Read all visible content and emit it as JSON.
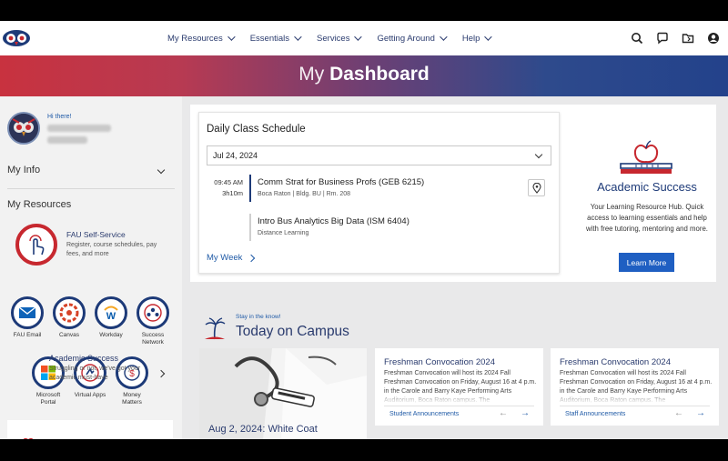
{
  "nav": {
    "items": [
      {
        "label": "My Resources"
      },
      {
        "label": "Essentials"
      },
      {
        "label": "Services"
      },
      {
        "label": "Getting Around"
      },
      {
        "label": "Help"
      }
    ],
    "icons": [
      "search-icon",
      "chat-icon",
      "folder-icon",
      "user-icon"
    ]
  },
  "banner": {
    "title_light": "My ",
    "title_bold": "Dashboard"
  },
  "sidebar": {
    "greeting": "Hi there!",
    "my_info": "My Info",
    "my_resources": "My Resources",
    "self_service": {
      "title": "FAU Self-Service",
      "description": "Register, course schedules, pay fees, and more"
    },
    "apps": [
      {
        "label": "FAU Email",
        "icon": "mail-icon"
      },
      {
        "label": "Canvas",
        "icon": "canvas-icon"
      },
      {
        "label": "Workday",
        "icon": "workday-icon"
      },
      {
        "label": "Success Network",
        "icon": "network-icon"
      },
      {
        "label": "Microsoft Portal",
        "icon": "microsoft-icon"
      },
      {
        "label": "Virtual Apps",
        "icon": "virtual-apps-icon"
      },
      {
        "label": "Money Matters",
        "icon": "money-icon"
      }
    ],
    "academic_success": {
      "title": "Academic Success",
      "description": "Struggling or not, we've got your academic must-have"
    }
  },
  "schedule": {
    "title": "Daily Class Schedule",
    "date": "Jul 24, 2024",
    "classes": [
      {
        "time": "09:45 AM",
        "duration": "3h10m",
        "name": "Comm Strat for Business Profs (GEB 6215)",
        "location": "Boca Raton | Bldg. BU | Rm. 208"
      },
      {
        "time": "",
        "duration": "",
        "name": "Intro Bus Analytics Big Data (ISM 6404)",
        "location": "Distance Learning"
      }
    ],
    "my_week": "My Week"
  },
  "academic_panel": {
    "title": "Academic Success",
    "description": "Your Learning Resource Hub. Quick access to learning essentials and help with free tutoring, mentoring and more.",
    "button": "Learn More"
  },
  "campus": {
    "kicker": "Stay in the know!",
    "title": "Today on Campus",
    "featured_caption": "Aug 2, 2024: White Coat",
    "cards": [
      {
        "title": "Freshman Convocation 2024",
        "body": "Freshman Convocation will host its 2024 Fall Freshman Convocation on Friday, August 16 at 4 p.m. in the Carole and Barry Kaye Performing Arts Auditorium, Boca Raton campus. The",
        "category": "Student Announcements"
      },
      {
        "title": "Freshman Convocation 2024",
        "body": "Freshman Convocation will host its 2024 Fall Freshman Convocation on Friday, August 16 at 4 p.m. in the Carole and Barry Kaye Performing Arts Auditorium, Boca Raton campus. The",
        "category": "Staff Announcements"
      }
    ]
  },
  "colors": {
    "navy": "#1d3a78",
    "fau_red": "#c7282f",
    "link_blue": "#1f5aa6",
    "button_blue": "#1f5fc2"
  }
}
